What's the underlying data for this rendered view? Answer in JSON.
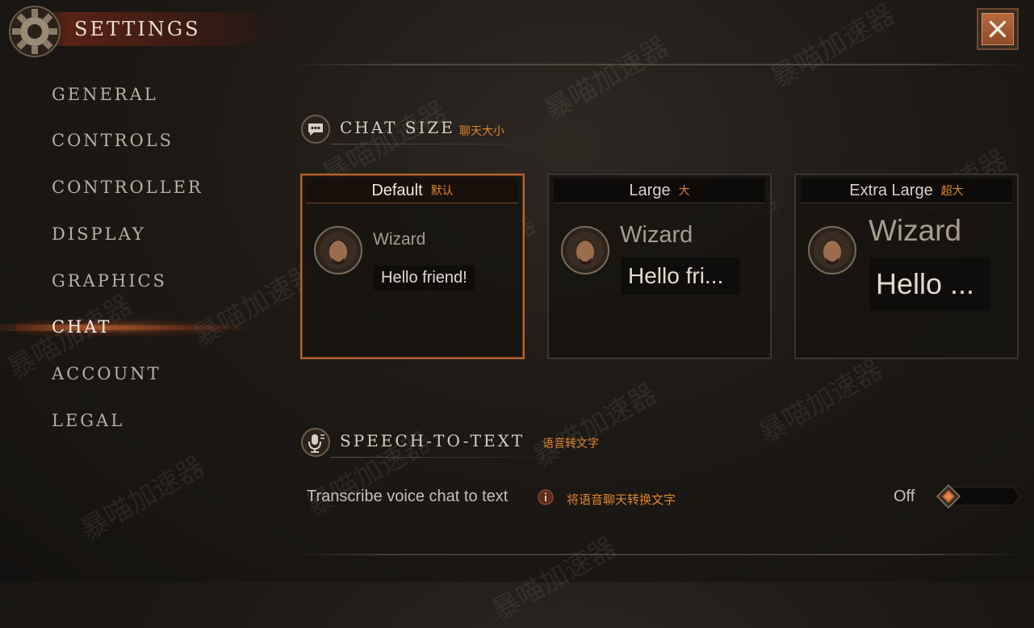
{
  "header": {
    "title": "SETTINGS",
    "close_icon": "close-icon"
  },
  "sidebar": {
    "items": [
      {
        "label": "GENERAL",
        "active": false
      },
      {
        "label": "CONTROLS",
        "active": false
      },
      {
        "label": "CONTROLLER",
        "active": false
      },
      {
        "label": "DISPLAY",
        "active": false
      },
      {
        "label": "GRAPHICS",
        "active": false
      },
      {
        "label": "CHAT",
        "active": true
      },
      {
        "label": "ACCOUNT",
        "active": false
      },
      {
        "label": "LEGAL",
        "active": false
      }
    ]
  },
  "chat_size": {
    "title": "CHAT SIZE",
    "title_cn": "聊天大小",
    "icon": "chat-bubble-icon",
    "options": [
      {
        "label": "Default",
        "label_cn": "默认",
        "speaker": "Wizard",
        "message": "Hello friend!",
        "selected": true
      },
      {
        "label": "Large",
        "label_cn": "大",
        "speaker": "Wizard",
        "message": "Hello fri...",
        "selected": false
      },
      {
        "label": "Extra Large",
        "label_cn": "超大",
        "speaker": "Wizard",
        "message": "Hello ...",
        "selected": false
      }
    ]
  },
  "speech_to_text": {
    "title": "SPEECH-TO-TEXT",
    "title_cn": "语音转文字",
    "icon": "microphone-icon",
    "setting_label": "Transcribe voice chat to text",
    "setting_label_cn": "将语音聊天转换文字",
    "info_icon": "info-icon",
    "toggle_state": "Off",
    "enabled": false
  },
  "watermark": "暴喵加速器",
  "colors": {
    "accent_orange": "#e0842e",
    "selected_border": "#b4612f",
    "close_button": "#a85d33"
  }
}
